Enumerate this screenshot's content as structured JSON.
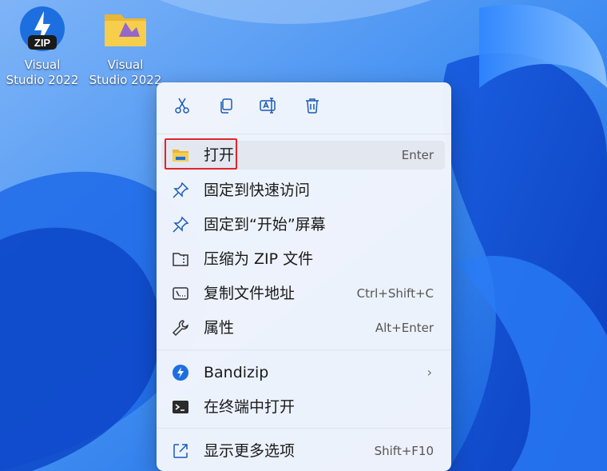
{
  "desktop": {
    "icons": [
      {
        "label": "Visual\nStudio 2022",
        "icon": "zip-archive-icon",
        "badge": "ZIP"
      },
      {
        "label": "Visual\nStudio 2022",
        "icon": "folder-icon"
      }
    ]
  },
  "context_menu": {
    "toolbar": [
      {
        "name": "cut",
        "icon": "scissors-icon"
      },
      {
        "name": "copy",
        "icon": "copy-icon"
      },
      {
        "name": "rename",
        "icon": "rename-icon"
      },
      {
        "name": "delete",
        "icon": "trash-icon"
      }
    ],
    "items": [
      {
        "label": "打开",
        "shortcut": "Enter",
        "icon": "folder-open-icon"
      },
      {
        "label": "固定到快速访问",
        "shortcut": "",
        "icon": "pin-icon"
      },
      {
        "label": "固定到“开始”屏幕",
        "shortcut": "",
        "icon": "pin-icon"
      },
      {
        "label": "压缩为 ZIP 文件",
        "shortcut": "",
        "icon": "zip-folder-icon"
      },
      {
        "label": "复制文件地址",
        "shortcut": "Ctrl+Shift+C",
        "icon": "copy-path-icon"
      },
      {
        "label": "属性",
        "shortcut": "Alt+Enter",
        "icon": "wrench-icon"
      },
      {
        "label": "Bandizip",
        "shortcut": "",
        "icon": "bandizip-icon",
        "submenu": true
      },
      {
        "label": "在终端中打开",
        "shortcut": "",
        "icon": "terminal-icon"
      },
      {
        "label": "显示更多选项",
        "shortcut": "Shift+F10",
        "icon": "external-icon"
      }
    ]
  },
  "colors": {
    "highlight_border": "#e0252b",
    "accent_blue": "#1d6fe0"
  }
}
